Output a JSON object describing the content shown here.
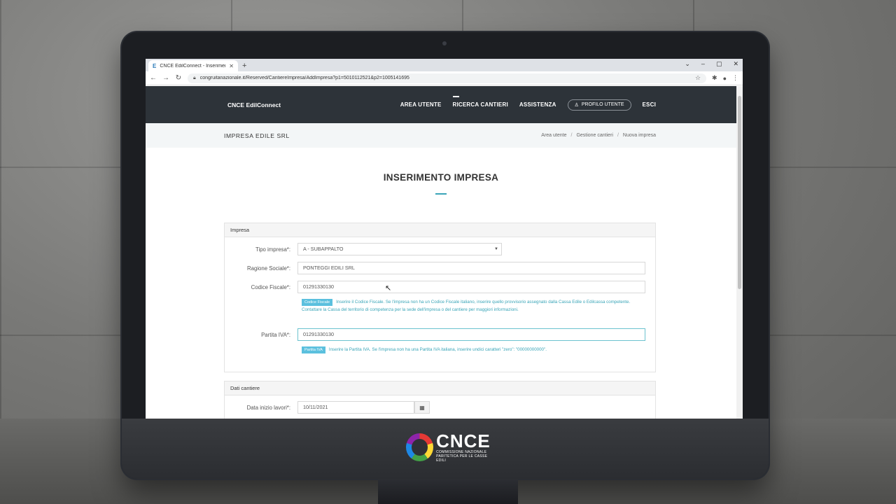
{
  "browser": {
    "tab_title": "CNCE EdilConnect - Inserimento",
    "favicon": "E",
    "url": "congruitanazionale.it/Reserved/CantiereImpresa/AddImpresa?p1=5010112521&p2=1005141695"
  },
  "topnav": {
    "brand": "CNCE EdilConnect",
    "menu": [
      {
        "label": "AREA UTENTE"
      },
      {
        "label": "RICERCA CANTIERI"
      },
      {
        "label": "ASSISTENZA"
      }
    ],
    "profile_label": "PROFILO UTENTE",
    "logout_label": "ESCI"
  },
  "subbar": {
    "company": "IMPRESA EDILE SRL",
    "breadcrumbs": [
      "Area utente",
      "Gestione cantieri",
      "Nuova impresa"
    ]
  },
  "page": {
    "title": "INSERIMENTO IMPRESA"
  },
  "impresa": {
    "section_title": "Impresa",
    "tipo_label": "Tipo impresa*:",
    "tipo_value": "A - SUBAPPALTO",
    "ragione_label": "Ragione Sociale*:",
    "ragione_value": "PONTEGGI EDILI SRL",
    "cf_label": "Codice Fiscale*:",
    "cf_value": "01291330130",
    "cf_badge": "Codice Fiscale",
    "cf_help": "Inserire il Codice Fiscale. Se l'impresa non ha un Codice Fiscale italiano, inserire quello provvisorio assegnato dalla Cassa Edile o Edilcassa competente. Contattare la Cassa del territorio di competenza per la sede dell'impresa o del cantiere per maggiori informazioni.",
    "piva_label": "Partita IVA*:",
    "piva_value": "01291330130",
    "piva_badge": "Partita IVA",
    "piva_help": "Inserire la Partita IVA. Se l'impresa non ha una Partita IVA italiana, inserire undici caratteri \"zero\": \"00000000000\"."
  },
  "cantiere": {
    "section_title": "Dati cantiere",
    "data_label": "Data inizio lavori*:",
    "data_value": "10/11/2021"
  },
  "logo": {
    "big": "CNCE",
    "small_1": "COMMISSIONE NAZIONALE",
    "small_2": "PARITETICA PER LE CASSE EDILI"
  },
  "icons": [
    "user-icon",
    "calendar-icon",
    "lock-icon",
    "star-icon",
    "puzzle-icon",
    "account-icon",
    "menu-dots-icon",
    "back-icon",
    "forward-icon",
    "reload-icon"
  ]
}
